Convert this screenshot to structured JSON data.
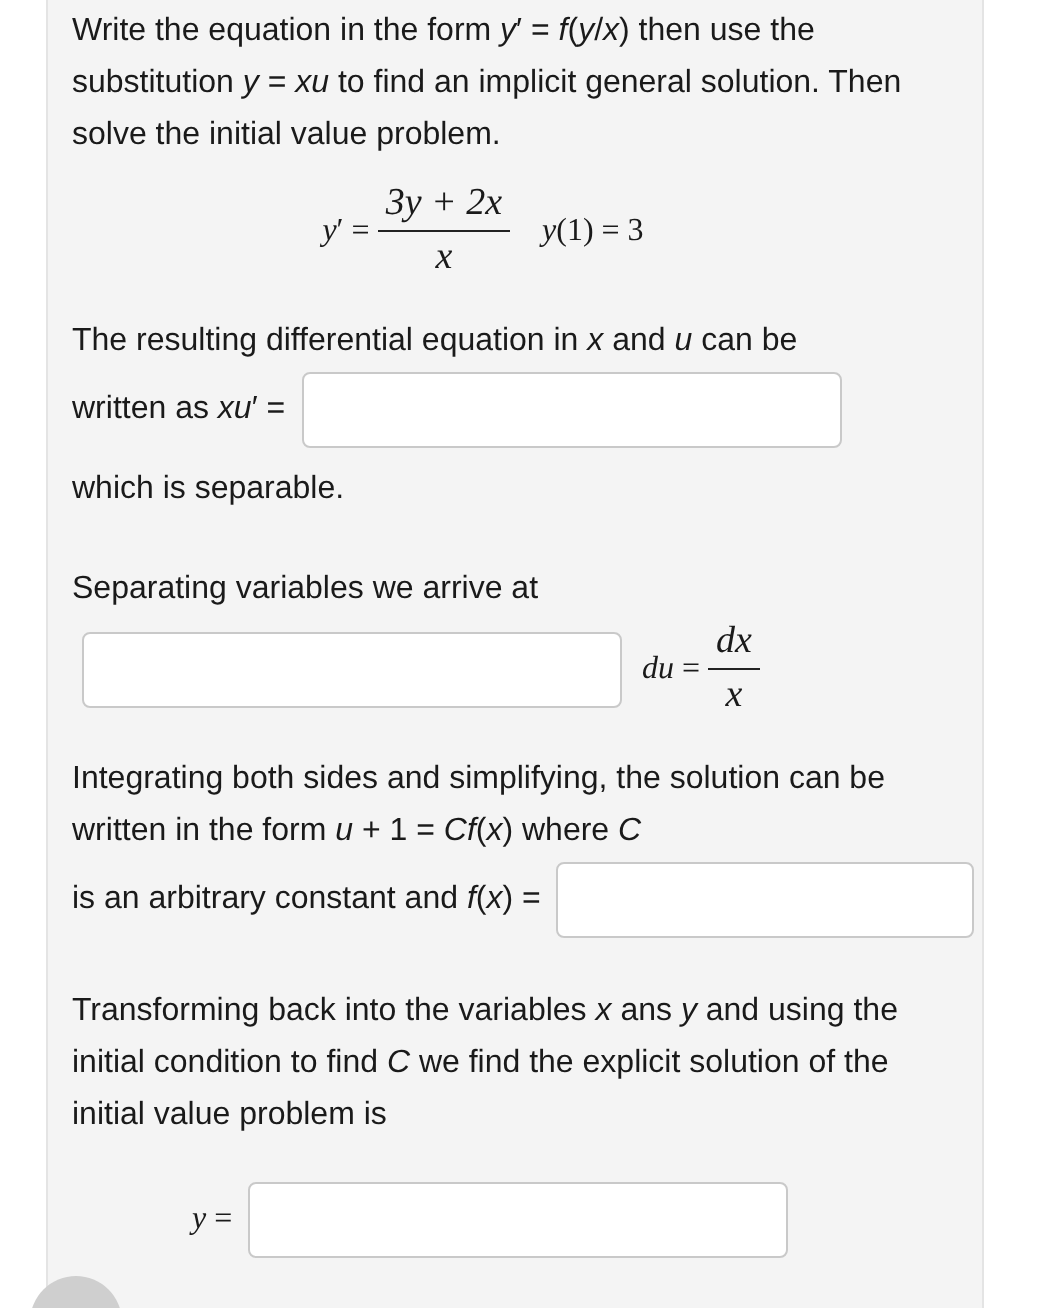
{
  "intro": "Write the equation in the form *y*′ = *f*(*y*/*x*) then use the substitution *y* = *xu* to find an implicit general solution. Then solve the initial value problem.",
  "equation": {
    "lhs": "*y*′ =",
    "numerator": "3y + 2x",
    "denominator": "x",
    "condition": "*y*(1) = 3"
  },
  "steps": [
    {
      "kind": "inline_answer",
      "lines": [
        "The resulting differential equation in *x* and *u* can be",
        "written as *xu*′ ="
      ],
      "after": "which is separable."
    },
    {
      "kind": "separation",
      "text": "Separating variables we arrive at",
      "lhs": "*du* =",
      "numerator": "dx",
      "denominator": "x"
    },
    {
      "kind": "inline_answer",
      "lines": [
        "Integrating both sides and simplifying, the solution can be written in the form *u* + 1 = *Cf*(*x*) where *C*",
        "is an arbitrary constant and *f*(*x*) ="
      ]
    },
    {
      "kind": "final",
      "text": "Transforming back into the variables *x* ans *y* and using the initial condition to find *C* we find the explicit solution of the initial value problem is",
      "lhs": "*y* ="
    }
  ]
}
